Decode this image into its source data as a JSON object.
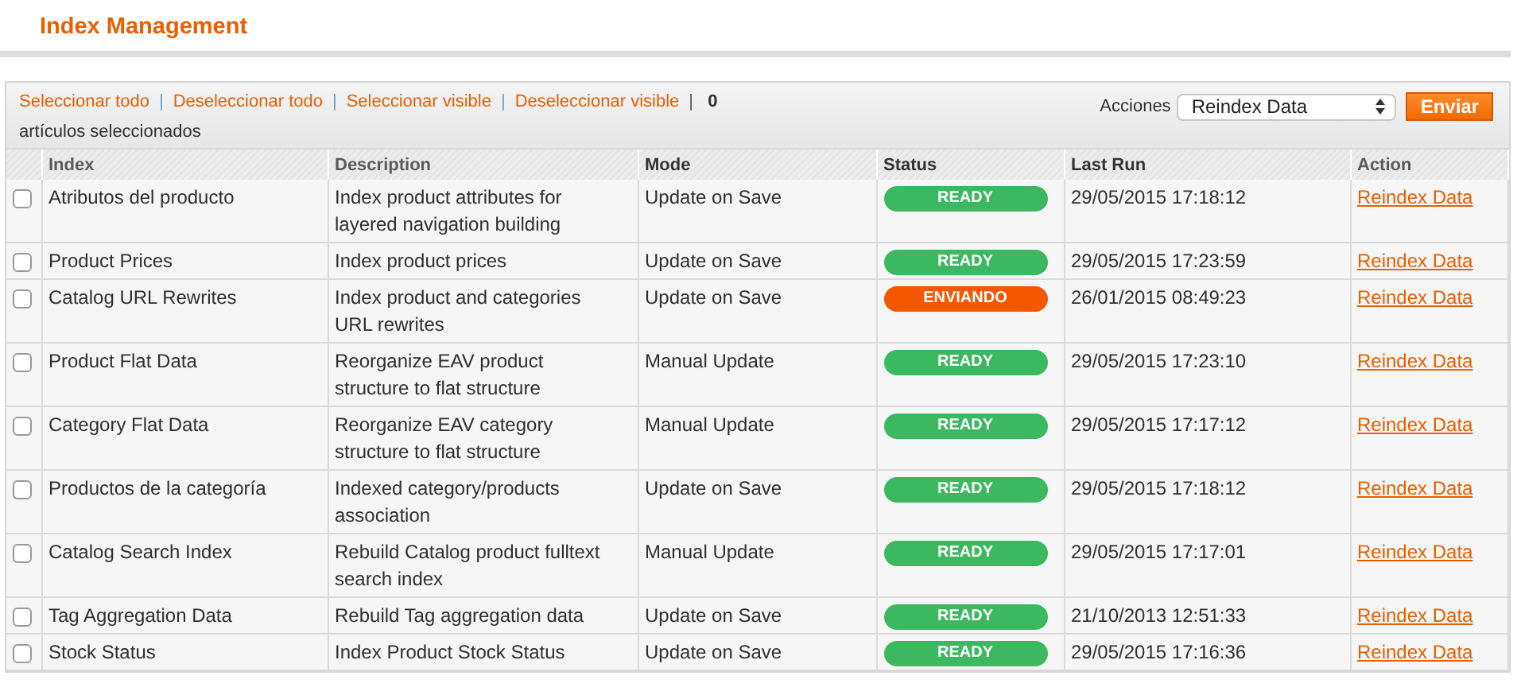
{
  "title": "Index Management",
  "mass_actions": {
    "separator": "|",
    "links": [
      "Seleccionar todo",
      "Deseleccionar todo",
      "Seleccionar visible",
      "Deseleccionar visible"
    ],
    "count": "0",
    "count_label": "artículos seleccionados",
    "actions_label": "Acciones",
    "action_value": "Reindex Data",
    "submit": "Enviar"
  },
  "table": {
    "columns": [
      "Index",
      "Description",
      "Mode",
      "Status",
      "Last Run",
      "Action"
    ],
    "rows": [
      {
        "checked": false,
        "index": "Atributos del producto",
        "description": "Index product attributes for layered navigation building",
        "mode": "Update on Save",
        "status": {
          "kind": "ready",
          "label": "READY"
        },
        "last_run": "29/05/2015 17:18:12",
        "action": "Reindex Data"
      },
      {
        "checked": false,
        "index": "Product Prices",
        "description": "Index product prices",
        "mode": "Update on Save",
        "status": {
          "kind": "ready",
          "label": "READY"
        },
        "last_run": "29/05/2015 17:23:59",
        "action": "Reindex Data"
      },
      {
        "checked": false,
        "index": "Catalog URL Rewrites",
        "description": "Index product and categories URL rewrites",
        "mode": "Update on Save",
        "status": {
          "kind": "processing",
          "label": "ENVIANDO"
        },
        "last_run": "26/01/2015 08:49:23",
        "action": "Reindex Data"
      },
      {
        "checked": false,
        "index": "Product Flat Data",
        "description": "Reorganize EAV product structure to flat structure",
        "mode": "Manual Update",
        "status": {
          "kind": "ready",
          "label": "READY"
        },
        "last_run": "29/05/2015 17:23:10",
        "action": "Reindex Data"
      },
      {
        "checked": false,
        "index": "Category Flat Data",
        "description": "Reorganize EAV category structure to flat structure",
        "mode": "Manual Update",
        "status": {
          "kind": "ready",
          "label": "READY"
        },
        "last_run": "29/05/2015 17:17:12",
        "action": "Reindex Data"
      },
      {
        "checked": false,
        "index": "Productos de la categoría",
        "description": "Indexed category/products association",
        "mode": "Update on Save",
        "status": {
          "kind": "ready",
          "label": "READY"
        },
        "last_run": "29/05/2015 17:18:12",
        "action": "Reindex Data"
      },
      {
        "checked": false,
        "index": "Catalog Search Index",
        "description": "Rebuild Catalog product fulltext search index",
        "mode": "Manual Update",
        "status": {
          "kind": "ready",
          "label": "READY"
        },
        "last_run": "29/05/2015 17:17:01",
        "action": "Reindex Data"
      },
      {
        "checked": false,
        "index": "Tag Aggregation Data",
        "description": "Rebuild Tag aggregation data",
        "mode": "Update on Save",
        "status": {
          "kind": "ready",
          "label": "READY"
        },
        "last_run": "21/10/2013 12:51:33",
        "action": "Reindex Data"
      },
      {
        "checked": false,
        "index": "Stock Status",
        "description": "Index Product Stock Status",
        "mode": "Update on Save",
        "status": {
          "kind": "ready",
          "label": "READY"
        },
        "last_run": "29/05/2015 17:16:36",
        "action": "Reindex Data"
      }
    ]
  }
}
